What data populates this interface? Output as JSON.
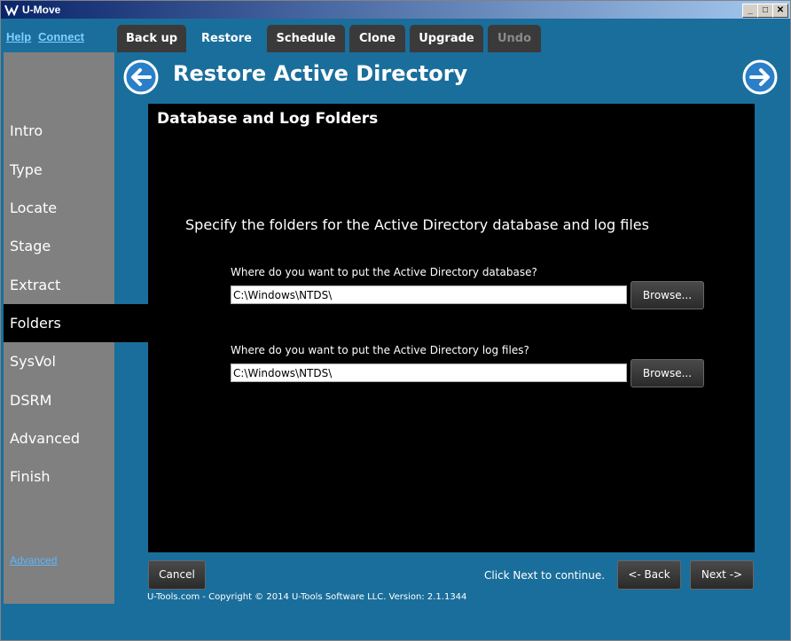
{
  "window": {
    "title": "U-Move"
  },
  "top_links": {
    "help": "Help",
    "connect": "Connect"
  },
  "tabs": [
    {
      "label": "Back up",
      "state": "normal"
    },
    {
      "label": "Restore",
      "state": "active"
    },
    {
      "label": "Schedule",
      "state": "normal"
    },
    {
      "label": "Clone",
      "state": "normal"
    },
    {
      "label": "Upgrade",
      "state": "normal"
    },
    {
      "label": "Undo",
      "state": "disabled"
    }
  ],
  "header": {
    "title": "Restore Active Directory"
  },
  "sidebar": {
    "items": [
      "Intro",
      "Type",
      "Locate",
      "Stage",
      "Extract",
      "Folders",
      "SysVol",
      "DSRM",
      "Advanced",
      "Finish"
    ],
    "active": "Folders",
    "advanced_link": "Advanced"
  },
  "panel": {
    "title": "Database and Log Folders",
    "instructions": "Specify the folders for the Active Directory database and log files",
    "database": {
      "label": "Where do you want to put the Active Directory database?",
      "value": "C:\\Windows\\NTDS\\",
      "browse": "Browse..."
    },
    "logs": {
      "label": "Where do you want to put the Active Directory log files?",
      "value": "C:\\Windows\\NTDS\\",
      "browse": "Browse..."
    }
  },
  "footer": {
    "cancel": "Cancel",
    "status": "Click Next to continue.",
    "back": "<- Back",
    "next": "Next ->",
    "copyright": "U-Tools.com - Copyright © 2014 U-Tools Software LLC.    Version: 2.1.1344"
  },
  "colors": {
    "background": "#1a6e9b",
    "sidebar": "#808080",
    "panel": "#000000",
    "link": "#7fd0ff"
  }
}
